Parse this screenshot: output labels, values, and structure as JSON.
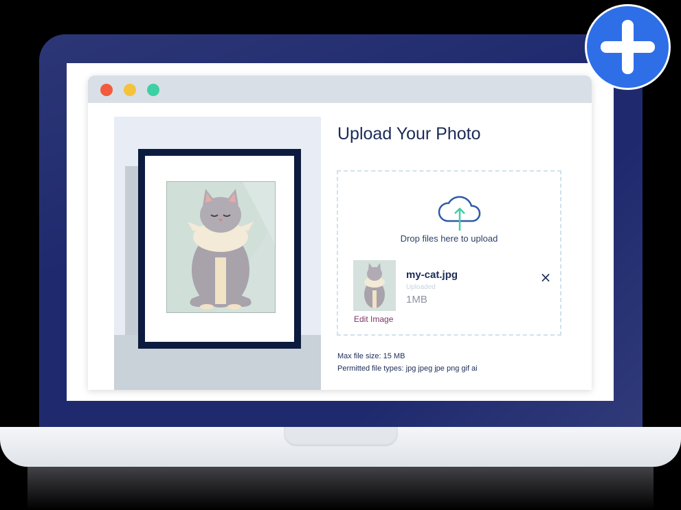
{
  "upload": {
    "title": "Upload Your Photo",
    "drop_text": "Drop files here to upload",
    "file": {
      "name": "my-cat.jpg",
      "status": "Uploaded",
      "size": "1MB",
      "edit_label": "Edit Image",
      "remove_icon": "×"
    },
    "max_size_text": "Max file size: 15 MB",
    "permitted_types_text": "Permitted file types: jpg jpeg jpe png gif ai"
  },
  "icons": {
    "cloud": "cloud-upload-icon",
    "add": "plus-icon",
    "close": "close-icon"
  },
  "colors": {
    "accent_blue": "#2e6fe8",
    "laptop_lid": "#1f2a6e",
    "title_text": "#1b2b57",
    "edit_link": "#7d3566",
    "upload_arrow": "#3ecfa5",
    "window_close": "#f25b3d",
    "window_minimize": "#f5c33b",
    "window_maximize": "#3ecfa5"
  }
}
